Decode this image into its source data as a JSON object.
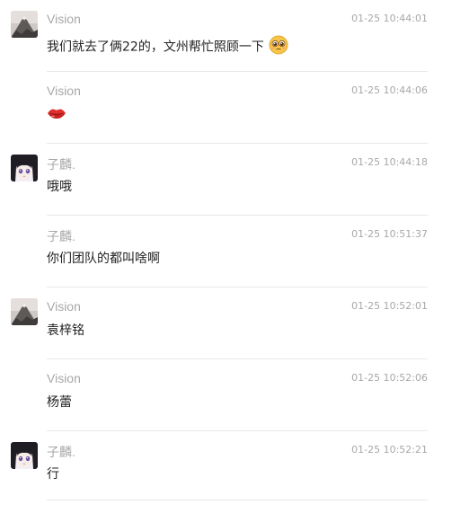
{
  "messages": [
    {
      "sender": "Vision",
      "time": "01-25 10:44:01",
      "text": "我们就去了俩22的，文州帮忙照顾一下",
      "avatar": "mountain-avatar",
      "emoji": "pleading-face-emoji"
    },
    {
      "sender": "Vision",
      "time": "01-25 10:44:06",
      "text": "",
      "emoji": "lips-emoji"
    },
    {
      "sender": "子麟.",
      "time": "01-25 10:44:18",
      "text": "哦哦",
      "avatar": "anime-girl-avatar"
    },
    {
      "sender": "子麟.",
      "time": "01-25 10:51:37",
      "text": "你们团队的都叫啥啊"
    },
    {
      "sender": "Vision",
      "time": "01-25 10:52:01",
      "text": "袁梓铭",
      "avatar": "mountain-avatar"
    },
    {
      "sender": "Vision",
      "time": "01-25 10:52:06",
      "text": "杨蕾"
    },
    {
      "sender": "子麟.",
      "time": "01-25 10:52:21",
      "text": "行",
      "avatar": "anime-girl-avatar"
    }
  ]
}
